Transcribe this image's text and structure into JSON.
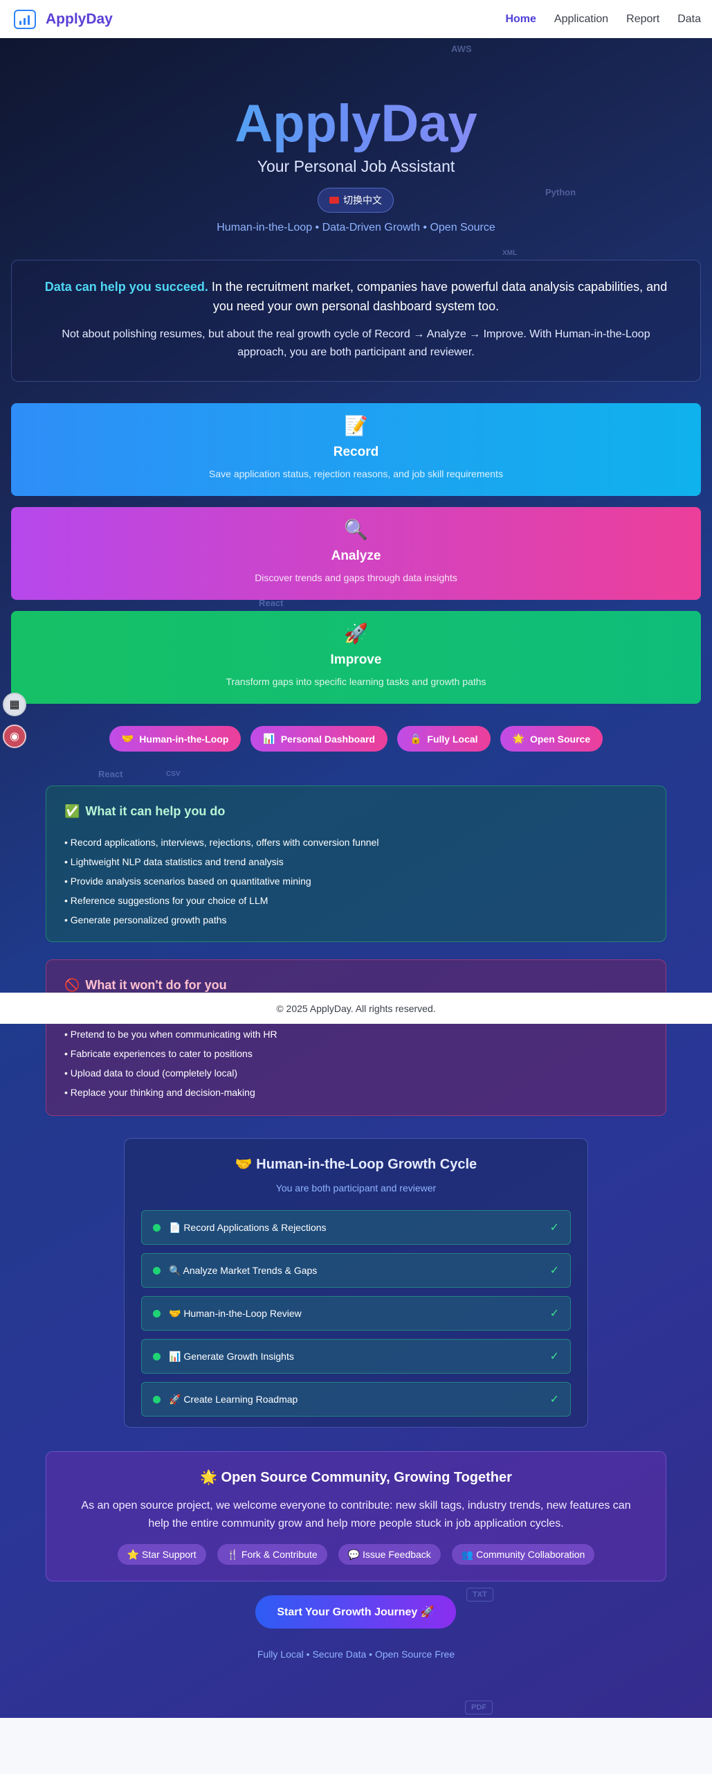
{
  "nav": {
    "brand": "ApplyDay",
    "links": [
      "Home",
      "Application",
      "Report",
      "Data"
    ]
  },
  "hero": {
    "title": "ApplyDay",
    "subtitle": "Your Personal Job Assistant",
    "lang_button": "切换中文",
    "tagline": "Human-in-the-Loop • Data-Driven Growth • Open Source",
    "floaters": [
      "AWS",
      "Python",
      "XML",
      "React",
      "React",
      "CSV",
      "TXT",
      "PDF"
    ]
  },
  "intro": {
    "highlight": "Data can help you succeed.",
    "line1": " In the recruitment market, companies have powerful data analysis capabilities, and you need your own personal dashboard system too.",
    "line2": "Not about polishing resumes, but about the real growth cycle of Record → Analyze → Improve. With Human-in-the-Loop approach, you are both participant and reviewer."
  },
  "steps": [
    {
      "icon": "📝",
      "title": "Record",
      "desc": "Save application status, rejection reasons, and job skill requirements"
    },
    {
      "icon": "🔍",
      "title": "Analyze",
      "desc": "Discover trends and gaps through data insights"
    },
    {
      "icon": "🚀",
      "title": "Improve",
      "desc": "Transform gaps into specific learning tasks and growth paths"
    }
  ],
  "pills": [
    {
      "icon": "🤝",
      "label": "Human-in-the-Loop"
    },
    {
      "icon": "📊",
      "label": "Personal Dashboard"
    },
    {
      "icon": "🔒",
      "label": "Fully Local"
    },
    {
      "icon": "🌟",
      "label": "Open Source"
    }
  ],
  "can": {
    "icon": "✅",
    "title": "What it can help you do",
    "items": [
      "Record applications, interviews, rejections, offers with conversion funnel",
      "Lightweight NLP data statistics and trend analysis",
      "Provide analysis scenarios based on quantitative mining",
      "Reference suggestions for your choice of LLM",
      "Generate personalized growth paths"
    ]
  },
  "wont": {
    "icon": "🚫",
    "title": "What it won't do for you",
    "items": [
      "Pretend to be you when communicating with HR",
      "Fabricate experiences to cater to positions",
      "Upload data to cloud (completely local)",
      "Replace your thinking and decision-making"
    ]
  },
  "cycle": {
    "title": "🤝 Human-in-the-Loop Growth Cycle",
    "subtitle": "You are both participant and reviewer",
    "items": [
      "📄 Record Applications & Rejections",
      "🔍 Analyze Market Trends & Gaps",
      "🤝 Human-in-the-Loop Review",
      "📊 Generate Growth Insights",
      "🚀 Create Learning Roadmap"
    ],
    "check": "✓"
  },
  "community": {
    "title": "🌟 Open Source Community, Growing Together",
    "text": "As an open source project, we welcome everyone to contribute: new skill tags, industry trends, new features can help the entire community grow and help more people stuck in job application cycles.",
    "chips": [
      "⭐ Star Support",
      "🍴 Fork & Contribute",
      "💬 Issue Feedback",
      "👥 Community Collaboration"
    ]
  },
  "cta": {
    "label": "Start Your Growth Journey 🚀",
    "sub": "Fully Local • Secure Data • Open Source Free"
  },
  "footer": "© 2025 ApplyDay. All rights reserved."
}
